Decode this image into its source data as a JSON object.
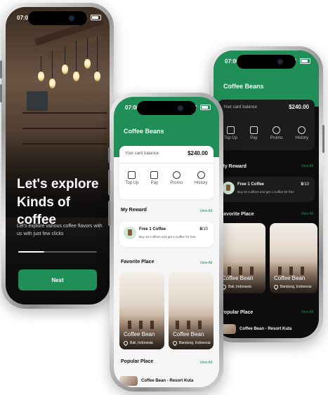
{
  "onboarding": {
    "time": "07:00",
    "title_line1": "Let's explore",
    "title_line2": "Kinds of coffee",
    "subtitle": "Let's explore various coffee flavors with us with just few clicks",
    "next_label": "Next",
    "progress_fraction": 0.33
  },
  "light_app": {
    "time": "07:00",
    "title": "Coffee Beans",
    "balance_label": "Your card balance",
    "balance_value": "$240.00",
    "actions": [
      "Top Up",
      "Pay",
      "Promo",
      "History"
    ],
    "reward_section": "My Reward",
    "reward_view_all": "View All",
    "reward": {
      "title": "Free 1 Coffee",
      "desc": "Buy 10 Coffees and get 1 Coffee for free",
      "count": "8",
      "total": "/10"
    },
    "favorite_section": "Favorite Place",
    "favorite_view_all": "View All",
    "places": [
      {
        "name": "Coffee Bean",
        "location": "Bali, Indonesia"
      },
      {
        "name": "Coffee Bean",
        "location": "Bandung, Indonesia"
      }
    ],
    "popular_section": "Popular Place",
    "popular_view_all": "View All",
    "popular_item": "Coffee Bean - Resort Kuta"
  },
  "dark_app": {
    "time": "07:00",
    "title": "Coffee Beans",
    "balance_label": "Your card balance",
    "balance_value": "$240.00",
    "actions": [
      "Top Up",
      "Pay",
      "Promo",
      "History"
    ],
    "reward_section": "My Reward",
    "reward_view_all": "View All",
    "reward": {
      "title": "Free 1 Coffee",
      "desc": "Buy 10 Coffees and get 1 Coffee for free",
      "count": "8",
      "total": "/10"
    },
    "favorite_section": "Favorite Place",
    "favorite_view_all": "View All",
    "places": [
      {
        "name": "Coffee Bean",
        "location": "Bali, Indonesia"
      },
      {
        "name": "Coffee Bean",
        "location": "Bandung, Indonesia"
      }
    ],
    "popular_section": "Popular Place",
    "popular_view_all": "View All",
    "popular_item": "Coffee Bean - Resort Kuta"
  },
  "colors": {
    "brand_green": "#1f8f57",
    "dark_bg": "#0d0d0d",
    "light_bg": "#f4f5f4"
  },
  "icons": [
    "signal-icon",
    "wifi-icon",
    "battery-icon",
    "top-up-icon",
    "pay-icon",
    "promo-icon",
    "history-icon",
    "coffee-cup-icon",
    "location-pin-icon"
  ]
}
